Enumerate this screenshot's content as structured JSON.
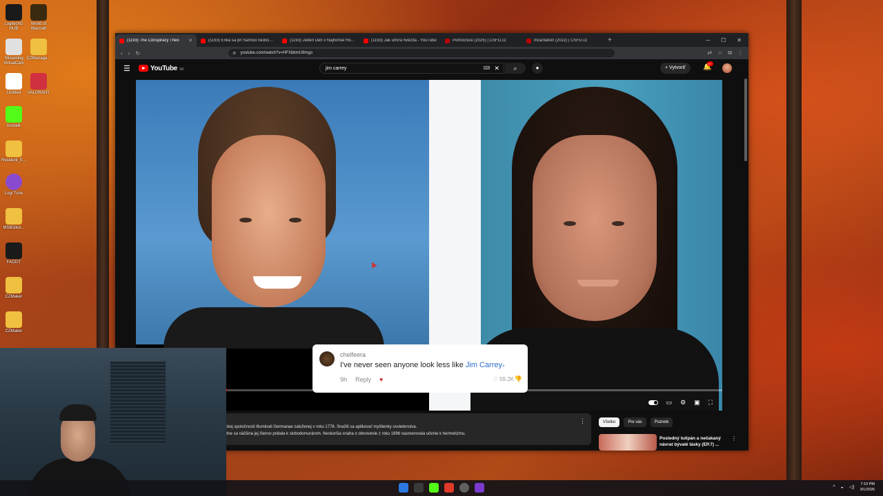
{
  "desktop": {
    "icons": [
      {
        "label": "LogitechG HUB",
        "icon": "logitech-icon",
        "color": "#1a1a1a"
      },
      {
        "label": "World of Warcraft",
        "icon": "wow-icon",
        "color": "#3a2a10"
      },
      {
        "label": "Streamlog VirtualCam",
        "icon": "camera-icon",
        "color": "#e0e0e0"
      },
      {
        "label": "CZManage...",
        "icon": "folder-icon",
        "color": "#f0c040"
      },
      {
        "label": "Untitled",
        "icon": "file-icon",
        "color": "#ffffff"
      },
      {
        "label": "VALORANT",
        "icon": "valorant-icon",
        "color": "#d03040"
      },
      {
        "label": "kicktalk",
        "icon": "kick-icon",
        "color": "#53fc18"
      },
      {
        "label": "Resident_E...",
        "icon": "folder-icon",
        "color": "#f0c040"
      },
      {
        "label": "Logi Tune",
        "icon": "logitune-icon",
        "color": "#8a4ad0"
      },
      {
        "label": "MSIEditor...",
        "icon": "folder-icon",
        "color": "#f0c040"
      },
      {
        "label": "FACEIT",
        "icon": "faceit-icon",
        "color": "#1a1a1a"
      },
      {
        "label": "CZMaker",
        "icon": "folder-icon",
        "color": "#f0c040"
      },
      {
        "label": "CZMaker",
        "icon": "folder-icon",
        "color": "#f0c040"
      }
    ]
  },
  "browser": {
    "tabs": [
      {
        "title": "(1193) The Conspiracy Theo",
        "active": true,
        "favicon": "#ff0000"
      },
      {
        "title": "(1193) Erika sa pri Samovi nedostalo",
        "active": false,
        "favicon": "#ff0000"
      },
      {
        "title": "(1193) Jeden Deň v Najhoršie Hodn",
        "active": false,
        "favicon": "#ff0000"
      },
      {
        "title": "(1193) Jak umírá hvězda - YouTube",
        "active": false,
        "favicon": "#ff0000"
      },
      {
        "title": "Pomocnice (2025) | ČSFD.cz",
        "active": false,
        "favicon": "#ba0305"
      },
      {
        "title": "Incantation (2022) | ČSFD.cz",
        "active": false,
        "favicon": "#ba0305"
      }
    ],
    "new_tab": "+",
    "url": "youtube.com/watch?v=HFXbbmU9mgo"
  },
  "youtube": {
    "logo_text": "YouTube",
    "country": "SK",
    "search_value": "jim carrey",
    "create_label": "Vytvoriť",
    "notif_badge": "9+",
    "comment": {
      "user": "chelfeera",
      "text_before": "I've never seen anyone look less like ",
      "text_link": "Jim Carrey",
      "age": "9h",
      "reply": "Reply",
      "likes": "59.2K"
    },
    "progress": 0.15,
    "description_line1": "ckej spoločnosti Illuminati Germanae založenej v roku 1776. Snažili sa aplikovať myšlienky osvietenstva.",
    "description_line2": "dne sa väčšina jej členov pridala k slobodomurárom. Neskoršia snaha o obnovenie z roku 1896 nasmerovala učenie k hermetizmu.",
    "chips": [
      "Všetko",
      "Pre vás",
      "Pozreté"
    ],
    "rec_title": "Posledný tulipán a nečakaný návrat bývalé lásky (EP.7) ..."
  },
  "taskbar": {
    "time": "7:10 PM",
    "date": "3/1/2026"
  }
}
